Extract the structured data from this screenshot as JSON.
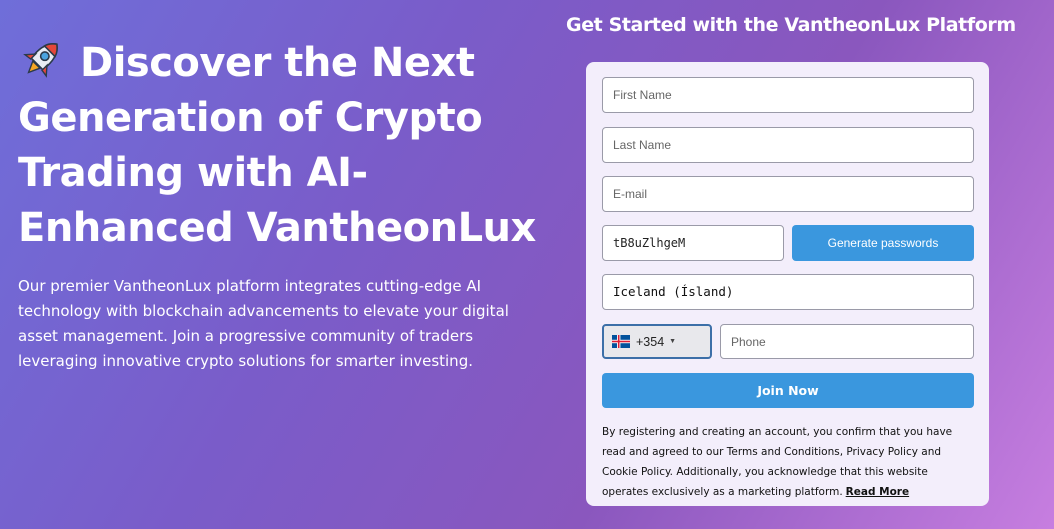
{
  "hero": {
    "title": "Discover the Next Generation of Crypto Trading with AI-Enhanced VantheonLux",
    "title_icon": "rocket-icon",
    "description": "Our premier VantheonLux platform integrates cutting-edge AI technology with blockchain advancements to elevate your digital asset management. Join a progressive community of traders leveraging innovative crypto solutions for smarter investing."
  },
  "form": {
    "heading": "Get Started with the VantheonLux Platform",
    "first_name_placeholder": "First Name",
    "last_name_placeholder": "Last Name",
    "email_placeholder": "E-mail",
    "password_value": "tB8uZlhgeM",
    "generate_label": "Generate passwords",
    "country_value": "Iceland (Ísland)",
    "dial_code": "+354",
    "flag_icon": "iceland-flag-icon",
    "phone_placeholder": "Phone",
    "join_label": "Join Now",
    "disclaimer": "By registering and creating an account, you confirm that you have read and agreed to our Terms and Conditions, Privacy Policy and Cookie Policy. Additionally, you acknowledge that this website operates exclusively as a marketing platform.",
    "read_more_label": "Read More"
  },
  "colors": {
    "accent_button": "#3a97de",
    "card_background": "#f3eefb"
  }
}
